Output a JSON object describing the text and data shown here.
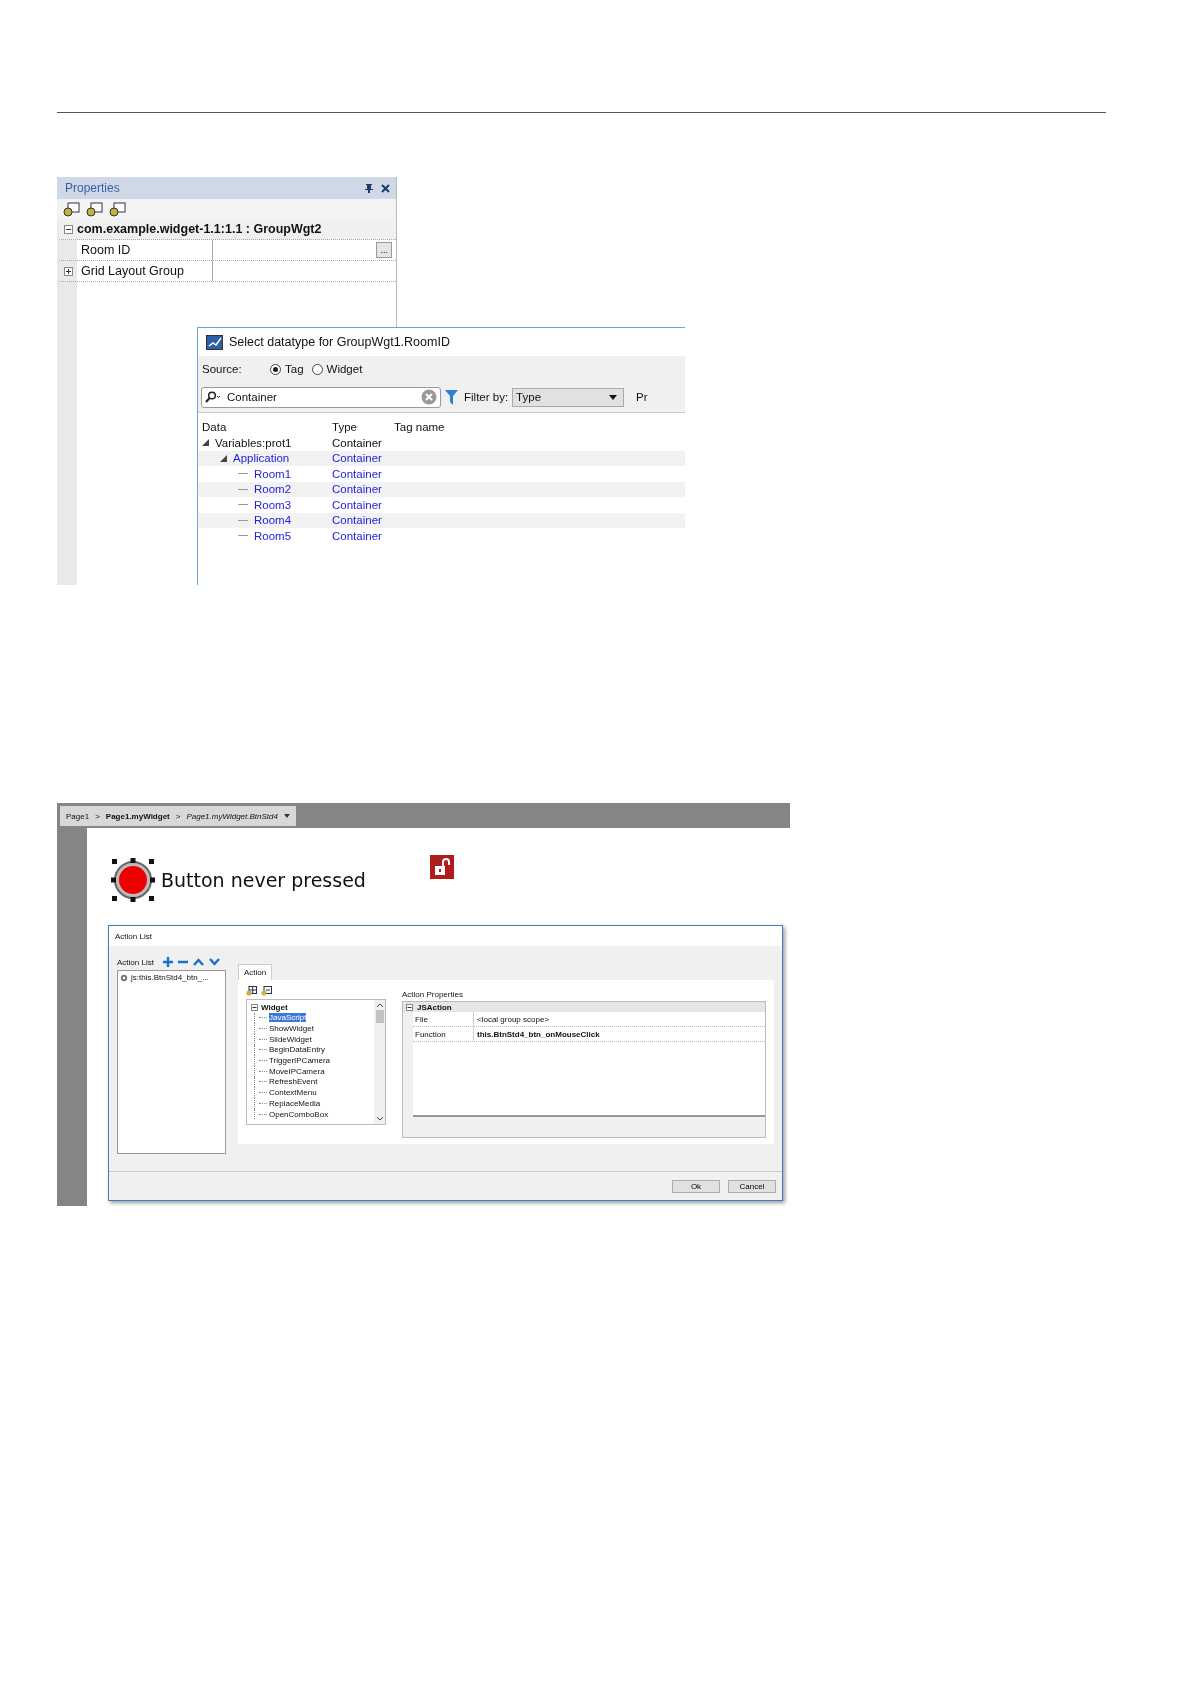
{
  "properties_panel": {
    "title": "Properties",
    "group": {
      "label": "com.example.widget-1.1:1.1 : GroupWgt2",
      "expanded": true
    },
    "rows": [
      {
        "label": "Room ID",
        "kind": "value",
        "button": "..."
      },
      {
        "label": "Grid Layout Group",
        "kind": "group",
        "expanded": false
      }
    ]
  },
  "datatype_dialog": {
    "title": "Select datatype for GroupWgt1.RoomID",
    "source_label": "Source:",
    "source_options": [
      {
        "label": "Tag",
        "selected": true
      },
      {
        "label": "Widget",
        "selected": false
      }
    ],
    "search": {
      "value": "Container"
    },
    "filter_label": "Filter by:",
    "filter_value": "Type",
    "column_4": "Pr",
    "columns": [
      "Data",
      "Type",
      "Tag name"
    ],
    "rows": [
      {
        "data": "Variables:prot1",
        "type": "Container",
        "expanded": true,
        "children": [
          {
            "data": "Application",
            "type": "Container",
            "expanded": true,
            "children": [
              {
                "data": "Room1",
                "type": "Container"
              },
              {
                "data": "Room2",
                "type": "Container"
              },
              {
                "data": "Room3",
                "type": "Container"
              },
              {
                "data": "Room4",
                "type": "Container"
              },
              {
                "data": "Room5",
                "type": "Container"
              }
            ]
          }
        ]
      }
    ]
  },
  "editor": {
    "breadcrumb": [
      {
        "label": "Page1",
        "kind": "plain"
      },
      {
        "separator": ">",
        "label": "Page1.myWidget",
        "kind": "bold"
      },
      {
        "separator": ">",
        "label": "Page1.myWidget.BtnStd4",
        "kind": "italic"
      }
    ],
    "button_label": "Button never pressed"
  },
  "action_dialog": {
    "title": "Action List",
    "list_label": "Action List",
    "list_items": [
      "js:this.BtnStd4_btn_..."
    ],
    "tabs": [
      {
        "label": "Action",
        "selected": true
      }
    ],
    "tree": {
      "label": "Widget",
      "expanded": true,
      "children": [
        {
          "label": "JavaScript",
          "selected": true
        },
        {
          "label": "ShowWidget",
          "selected": false
        },
        {
          "label": "SlideWidget",
          "selected": false
        },
        {
          "label": "BeginDataEntry",
          "selected": false
        },
        {
          "label": "TriggerIPCamera",
          "selected": false
        },
        {
          "label": "MoveIPCamera",
          "selected": false
        },
        {
          "label": "RefreshEvent",
          "selected": false
        },
        {
          "label": "ContextMenu",
          "selected": false
        },
        {
          "label": "ReplaceMedia",
          "selected": false
        },
        {
          "label": "OpenComboBox",
          "selected": false
        }
      ]
    },
    "properties_title": "Action Properties",
    "group": {
      "label": "JSAction",
      "expanded": true
    },
    "properties": [
      {
        "name": "File",
        "value": "<local group scope>",
        "kind": "plain"
      },
      {
        "name": "Function",
        "value": "this.BtnStd4_btn_onMouseClick",
        "kind": "bold"
      }
    ],
    "buttons": [
      "Ok",
      "Cancel"
    ]
  }
}
